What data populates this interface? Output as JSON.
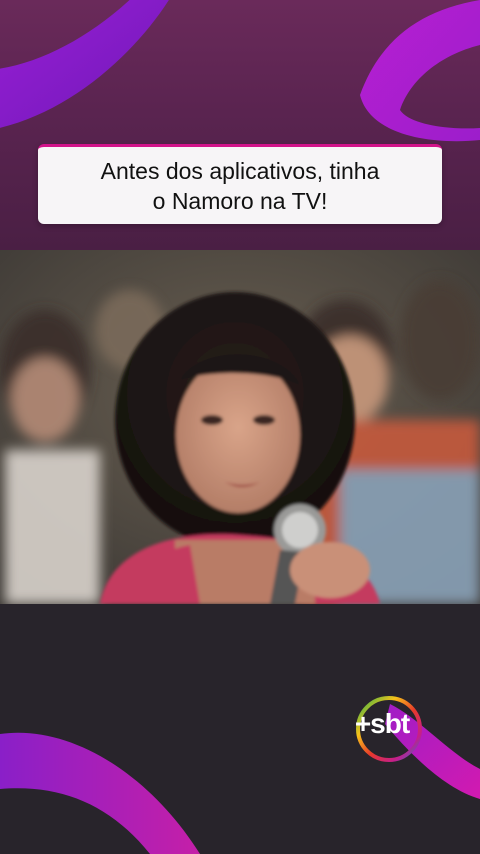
{
  "caption": {
    "text": "Antes dos aplicativos, tinha\no Namoro na TV!"
  },
  "brand": {
    "logo_text": "+sbt",
    "accent": "#d2138a",
    "purple": "#8a1fc8",
    "magenta": "#c51fa8"
  },
  "video": {
    "icon": "tv-show-still-frame"
  }
}
